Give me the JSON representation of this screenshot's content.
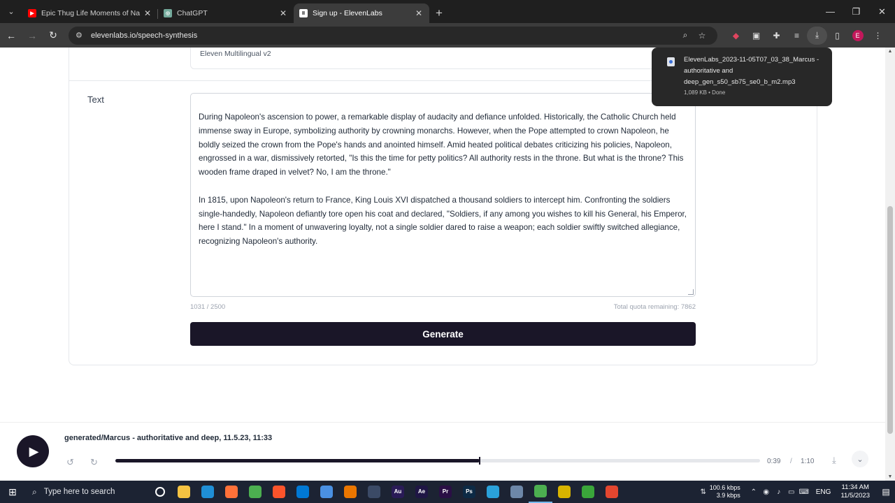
{
  "browser": {
    "tabs": [
      {
        "title": "Epic Thug Life Moments of Na",
        "icon": "youtube-icon",
        "color": "#ff0000"
      },
      {
        "title": "ChatGPT",
        "icon": "chatgpt-icon",
        "color": "#74aa9c"
      },
      {
        "title": "Sign up - ElevenLabs",
        "icon": "elevenlabs-icon",
        "color": "#ffffff",
        "active": true
      }
    ],
    "url": "elevenlabs.io/speech-synthesis",
    "profile_initial": "E"
  },
  "download_popup": {
    "filename": "ElevenLabs_2023-11-05T07_03_38_Marcus - authoritative and deep_gen_s50_sb75_se0_b_m2.mp3",
    "status": "1,089 KB • Done"
  },
  "form": {
    "model_value": "Eleven Multilingual v2",
    "text_label": "Text",
    "paragraphs": [
      "During Napoleon's ascension to power, a remarkable display of audacity and defiance unfolded. Historically, the Catholic Church held immense sway in Europe, symbolizing authority by crowning monarchs. However, when the Pope attempted to crown Napoleon, he boldly seized the crown from the Pope's hands and anointed himself. Amid heated political debates criticizing his policies, Napoleon, engrossed in a war, dismissively retorted, \"Is this the time for petty politics? All authority rests in the throne. But what is the throne? This wooden frame draped in velvet? No, I am the throne.\"",
      "In 1815, upon Napoleon's return to France, King Louis XVI dispatched a thousand soldiers to intercept him. Confronting the soldiers single-handedly, Napoleon defiantly tore open his coat and declared, \"Soldiers, if any among you wishes to kill his General, his Emperor, here I stand.\" In a moment of unwavering loyalty, not a single soldier dared to raise a weapon; each soldier swiftly switched allegiance, recognizing Napoleon's authority."
    ],
    "char_count": "1031 / 2500",
    "quota": "Total quota remaining: 7862",
    "generate_label": "Generate"
  },
  "player": {
    "title": "generated/Marcus - authoritative and deep, 11.5.23, 11:33",
    "current_time": "0:39",
    "separator": "/",
    "total_time": "1:10",
    "progress_fraction": 0.565
  },
  "taskbar": {
    "search_placeholder": "Type here to search",
    "net_up": "100.6 kbps",
    "net_down": "3.9 kbps",
    "language": "ENG",
    "time": "11:34 AM",
    "date": "11/5/2023",
    "apps": [
      {
        "name": "task-view",
        "label": "",
        "color": "#1c2333"
      },
      {
        "name": "file-explorer",
        "label": "",
        "color": "#f5c342"
      },
      {
        "name": "edge",
        "label": "",
        "color": "#1f8fd6"
      },
      {
        "name": "firefox",
        "label": "",
        "color": "#ff7139"
      },
      {
        "name": "chrome",
        "label": "",
        "color": "#4caf50"
      },
      {
        "name": "brave",
        "label": "",
        "color": "#fb542b"
      },
      {
        "name": "vscode",
        "label": "",
        "color": "#0078d4"
      },
      {
        "name": "app-store",
        "label": "",
        "color": "#4a90e2"
      },
      {
        "name": "blender",
        "label": "",
        "color": "#ea7600"
      },
      {
        "name": "davinci",
        "label": "",
        "color": "#3b4a66"
      },
      {
        "name": "audition",
        "label": "Au",
        "color": "#2a1b57"
      },
      {
        "name": "after-effects",
        "label": "Ae",
        "color": "#1f1645"
      },
      {
        "name": "premiere",
        "label": "Pr",
        "color": "#2a0f45"
      },
      {
        "name": "photoshop",
        "label": "Ps",
        "color": "#0d2a45"
      },
      {
        "name": "telegram",
        "label": "",
        "color": "#2aa1da"
      },
      {
        "name": "notepad",
        "label": "",
        "color": "#6d87a8"
      },
      {
        "name": "chrome-active",
        "label": "",
        "color": "#4caf50"
      },
      {
        "name": "folder-yellow",
        "label": "",
        "color": "#d8b400"
      },
      {
        "name": "camtasia",
        "label": "",
        "color": "#3aa63a"
      },
      {
        "name": "recorder",
        "label": "",
        "color": "#e3462f"
      }
    ]
  }
}
